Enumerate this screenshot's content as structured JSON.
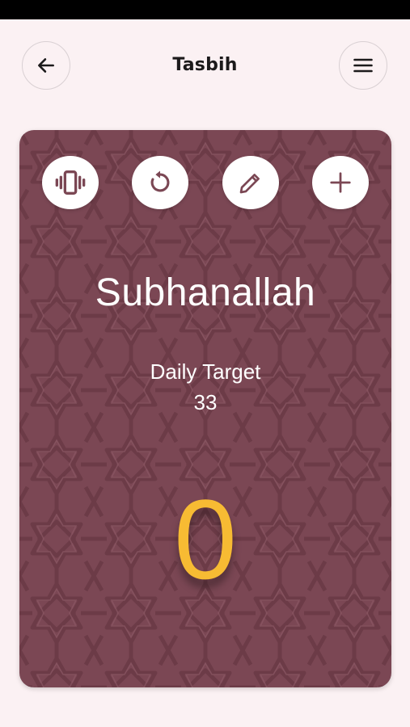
{
  "app_bar": {
    "title": "Tasbih",
    "back_icon": "arrow-left-icon",
    "menu_icon": "hamburger-menu-icon"
  },
  "card": {
    "background_color": "#7b4754",
    "actions": [
      {
        "name": "vibrate",
        "icon": "vibrate-icon"
      },
      {
        "name": "reset",
        "icon": "reset-icon"
      },
      {
        "name": "edit",
        "icon": "pencil-icon"
      },
      {
        "name": "add",
        "icon": "plus-icon"
      }
    ],
    "dhikr_name": "Subhanallah",
    "target_label": "Daily Target",
    "target_value": "33",
    "count": "0",
    "count_color": "#f7bb33"
  }
}
